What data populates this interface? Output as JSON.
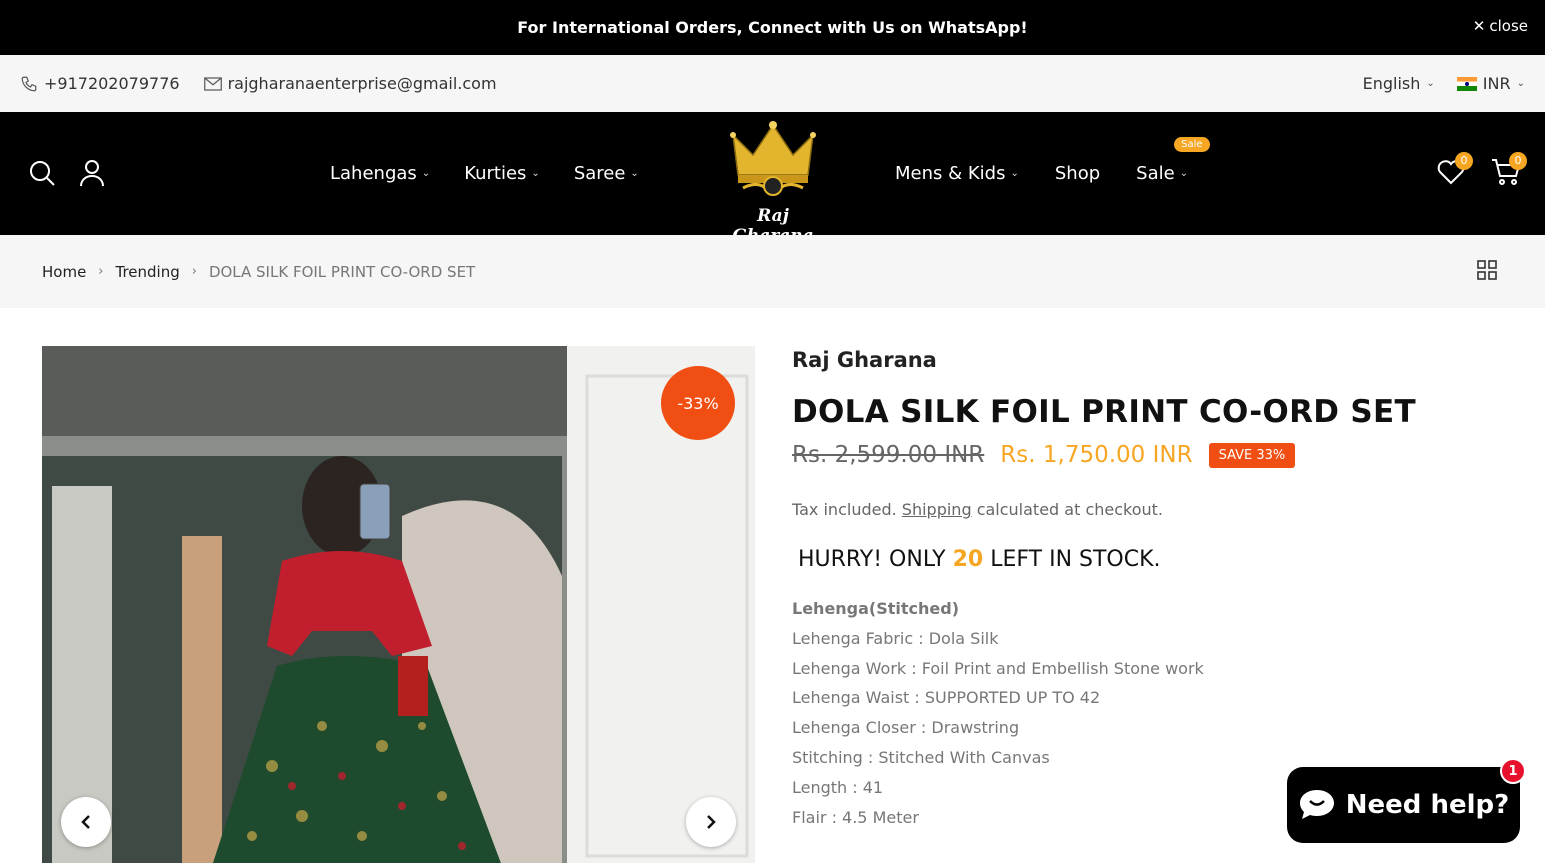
{
  "announcement": {
    "text": "For International Orders, Connect with Us on WhatsApp!",
    "close_label": "close"
  },
  "topbar": {
    "phone": "+917202079776",
    "email": "rajgharanaenterprise@gmail.com",
    "language": "English",
    "currency": "INR"
  },
  "header": {
    "nav_left": [
      "Lahengas",
      "Kurties",
      "Saree"
    ],
    "nav_right": [
      "Mens & Kids",
      "Shop",
      "Sale"
    ],
    "sale_badge": "Sale",
    "logo_text": "Raj Gharana",
    "wishlist_count": "0",
    "cart_count": "0"
  },
  "breadcrumb": {
    "home": "Home",
    "category": "Trending",
    "current": "DOLA SILK FOIL PRINT CO-ORD SET"
  },
  "product": {
    "discount_badge": "-33%",
    "vendor": "Raj Gharana",
    "title": "DOLA SILK FOIL PRINT CO-ORD SET",
    "compare_price": "Rs. 2,599.00 INR",
    "price": "Rs. 1,750.00 INR",
    "save_badge": "SAVE 33%",
    "tax_prefix": "Tax included.",
    "shipping_link": "Shipping",
    "tax_suffix": "calculated at checkout.",
    "stock_prefix": "HURRY! ONLY",
    "stock_count": "20",
    "stock_suffix": "LEFT IN STOCK.",
    "desc_heading": "Lehenga(Stitched)",
    "desc_lines": [
      "Lehenga Fabric : Dola Silk",
      "Lehenga Work : Foil Print and Embellish Stone work",
      "Lehenga Waist : SUPPORTED UP TO 42",
      "Lehenga Closer : Drawstring",
      "Stitching : Stitched With Canvas",
      "Length : 41",
      "Flair : 4.5 Meter"
    ]
  },
  "chat": {
    "label": "Need help?",
    "notification": "1"
  },
  "colors": {
    "accent": "#f6a623",
    "sale_red": "#f04e12",
    "header_bg": "#000000"
  }
}
